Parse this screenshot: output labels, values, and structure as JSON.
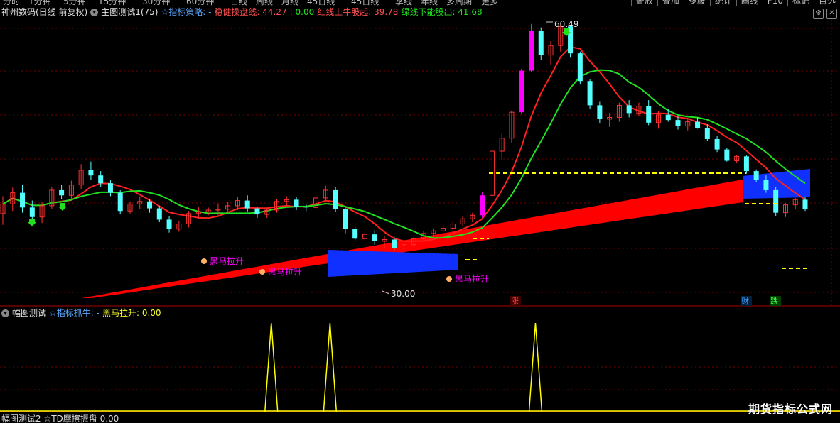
{
  "top_menu": {
    "items": [
      "分时",
      "1分钟",
      "5分钟",
      "15分钟",
      "30分钟",
      "60分钟",
      "日线",
      "周线",
      "月线",
      "45日线",
      "45日线",
      "季线",
      "年线",
      "多周期",
      "更多"
    ],
    "right_items": [
      "叠放",
      "叠加",
      "多股",
      "统计",
      "画线",
      "F10",
      "标记",
      "自选"
    ]
  },
  "main_header": {
    "stock": "神州数码(日线 前复权)",
    "formula": "主图测试1(75)",
    "strategy_label": "☆指标策略: -",
    "s1_label": "稳健操盘线: 44.27",
    "s1_extra": ": 0.00",
    "s2_label": "红线上牛股起: 39.78",
    "s3_label": "绿线下能股出: 41.68"
  },
  "sub_header": {
    "title": "幅图测试",
    "label1": "☆指标抓牛: -",
    "label2": "黑马拉升: 0.00"
  },
  "bottom_header": {
    "text": "幅图测试2 ☆TD摩擦振盘 0.00"
  },
  "annotations": {
    "high": "60.49",
    "low": "30.00",
    "signal": "黑马拉升",
    "tag_zhang": "涨",
    "tag_cai": "财",
    "tag_die": "跌"
  },
  "watermark": "期货指标公式网",
  "colors": {
    "up": "#ff3232",
    "down": "#54ffff",
    "ma_red": "#ff2020",
    "ma_green": "#20e020",
    "band_red": "#ff0000",
    "band_blue": "#1030ff",
    "magenta": "#ff00ff",
    "yellow": "#ffff00"
  },
  "chart_data": {
    "type": "candlestick",
    "high": 60.49,
    "low": 30.0,
    "candles": [
      [
        38.5,
        40.5,
        37.2,
        39.6
      ],
      [
        39.6,
        41.5,
        38.8,
        40.9
      ],
      [
        40.9,
        41.8,
        38.6,
        39.2
      ],
      [
        39.2,
        40.0,
        37.5,
        38.1
      ],
      [
        38.1,
        39.8,
        37.4,
        39.4
      ],
      [
        39.4,
        41.6,
        39.0,
        41.2
      ],
      [
        41.2,
        41.8,
        40.2,
        40.6
      ],
      [
        40.6,
        42.3,
        40.1,
        41.8
      ],
      [
        41.8,
        44.2,
        41.3,
        43.5
      ],
      [
        43.5,
        44.5,
        42.4,
        42.9
      ],
      [
        42.9,
        43.4,
        41.6,
        42.0
      ],
      [
        42.0,
        42.4,
        40.5,
        40.9
      ],
      [
        40.9,
        41.2,
        38.4,
        38.8
      ],
      [
        38.8,
        39.9,
        38.5,
        39.6
      ],
      [
        39.6,
        40.5,
        39.0,
        39.9
      ],
      [
        39.9,
        40.2,
        38.6,
        39.1
      ],
      [
        39.1,
        39.4,
        37.5,
        37.8
      ],
      [
        37.8,
        38.2,
        36.3,
        36.7
      ],
      [
        36.7,
        37.6,
        36.4,
        37.3
      ],
      [
        37.3,
        38.8,
        36.9,
        38.5
      ],
      [
        38.5,
        39.3,
        37.9,
        38.7
      ],
      [
        38.7,
        39.2,
        38.3,
        38.9
      ],
      [
        38.9,
        39.6,
        38.2,
        39.0
      ],
      [
        39.0,
        39.8,
        38.7,
        39.4
      ],
      [
        39.4,
        40.4,
        38.9,
        40.0
      ],
      [
        40.0,
        40.6,
        38.7,
        39.1
      ],
      [
        39.1,
        39.3,
        38.0,
        38.4
      ],
      [
        38.4,
        39.1,
        38.0,
        38.9
      ],
      [
        38.9,
        40.2,
        38.6,
        39.9
      ],
      [
        39.9,
        40.5,
        39.4,
        40.1
      ],
      [
        40.1,
        40.4,
        38.9,
        39.3
      ],
      [
        39.3,
        39.6,
        38.8,
        39.2
      ],
      [
        39.2,
        40.6,
        39.0,
        40.3
      ],
      [
        40.3,
        41.7,
        39.9,
        41.2
      ],
      [
        41.2,
        41.6,
        38.7,
        39.0
      ],
      [
        39.0,
        39.2,
        36.2,
        36.7
      ],
      [
        36.7,
        37.0,
        35.4,
        35.6
      ],
      [
        35.6,
        36.4,
        35.2,
        36.1
      ],
      [
        36.1,
        36.6,
        34.9,
        35.3
      ],
      [
        35.3,
        35.9,
        34.5,
        35.5
      ],
      [
        35.5,
        35.9,
        34.3,
        34.5
      ],
      [
        34.5,
        35.2,
        33.6,
        34.9
      ],
      [
        34.9,
        35.8,
        34.6,
        35.6
      ],
      [
        35.6,
        36.5,
        35.3,
        36.2
      ],
      [
        36.2,
        36.8,
        35.8,
        36.5
      ],
      [
        36.5,
        37.0,
        36.1,
        36.8
      ],
      [
        36.8,
        37.6,
        36.5,
        37.3
      ],
      [
        37.3,
        38.2,
        37.1,
        37.9
      ],
      [
        37.9,
        38.6,
        37.5,
        38.3
      ],
      [
        38.3,
        41.0,
        38.0,
        40.6
      ],
      [
        40.6,
        45.8,
        40.6,
        45.7
      ],
      [
        45.7,
        47.7,
        44.7,
        47.2
      ],
      [
        47.2,
        50.4,
        46.7,
        50.2
      ],
      [
        50.2,
        55.2,
        50.0,
        55.0
      ],
      [
        55.0,
        60.4,
        54.8,
        59.6
      ],
      [
        59.6,
        60.0,
        56.2,
        56.8
      ],
      [
        56.8,
        58.4,
        55.7,
        57.9
      ],
      [
        57.9,
        60.49,
        57.2,
        60.1
      ],
      [
        60.1,
        60.2,
        56.5,
        57.0
      ],
      [
        57.0,
        57.2,
        53.4,
        53.8
      ],
      [
        53.8,
        54.0,
        50.6,
        51.0
      ],
      [
        51.0,
        51.4,
        48.9,
        49.4
      ],
      [
        49.4,
        50.1,
        48.5,
        49.6
      ],
      [
        49.6,
        51.3,
        49.1,
        51.0
      ],
      [
        51.0,
        51.6,
        49.6,
        50.1
      ],
      [
        50.1,
        51.3,
        49.8,
        50.9
      ],
      [
        50.9,
        51.6,
        48.7,
        49.0
      ],
      [
        49.0,
        50.3,
        48.3,
        49.9
      ],
      [
        49.9,
        50.6,
        49.1,
        49.3
      ],
      [
        49.3,
        49.7,
        48.2,
        48.6
      ],
      [
        48.6,
        49.4,
        48.1,
        49.1
      ],
      [
        49.1,
        49.6,
        48.3,
        48.4
      ],
      [
        48.4,
        48.8,
        46.9,
        47.1
      ],
      [
        47.1,
        47.5,
        45.6,
        45.9
      ],
      [
        45.9,
        46.1,
        44.5,
        44.6
      ],
      [
        44.6,
        45.3,
        44.3,
        45.1
      ],
      [
        45.1,
        45.2,
        43.1,
        43.4
      ],
      [
        43.4,
        43.6,
        42.1,
        42.4
      ],
      [
        42.4,
        42.9,
        40.9,
        41.2
      ],
      [
        41.2,
        41.6,
        38.2,
        38.6
      ],
      [
        38.6,
        39.7,
        38.1,
        39.5
      ],
      [
        39.5,
        40.3,
        39.0,
        40.1
      ],
      [
        40.1,
        40.4,
        38.8,
        39.0
      ]
    ],
    "black_horse_signals": [
      27,
      33,
      54
    ]
  }
}
